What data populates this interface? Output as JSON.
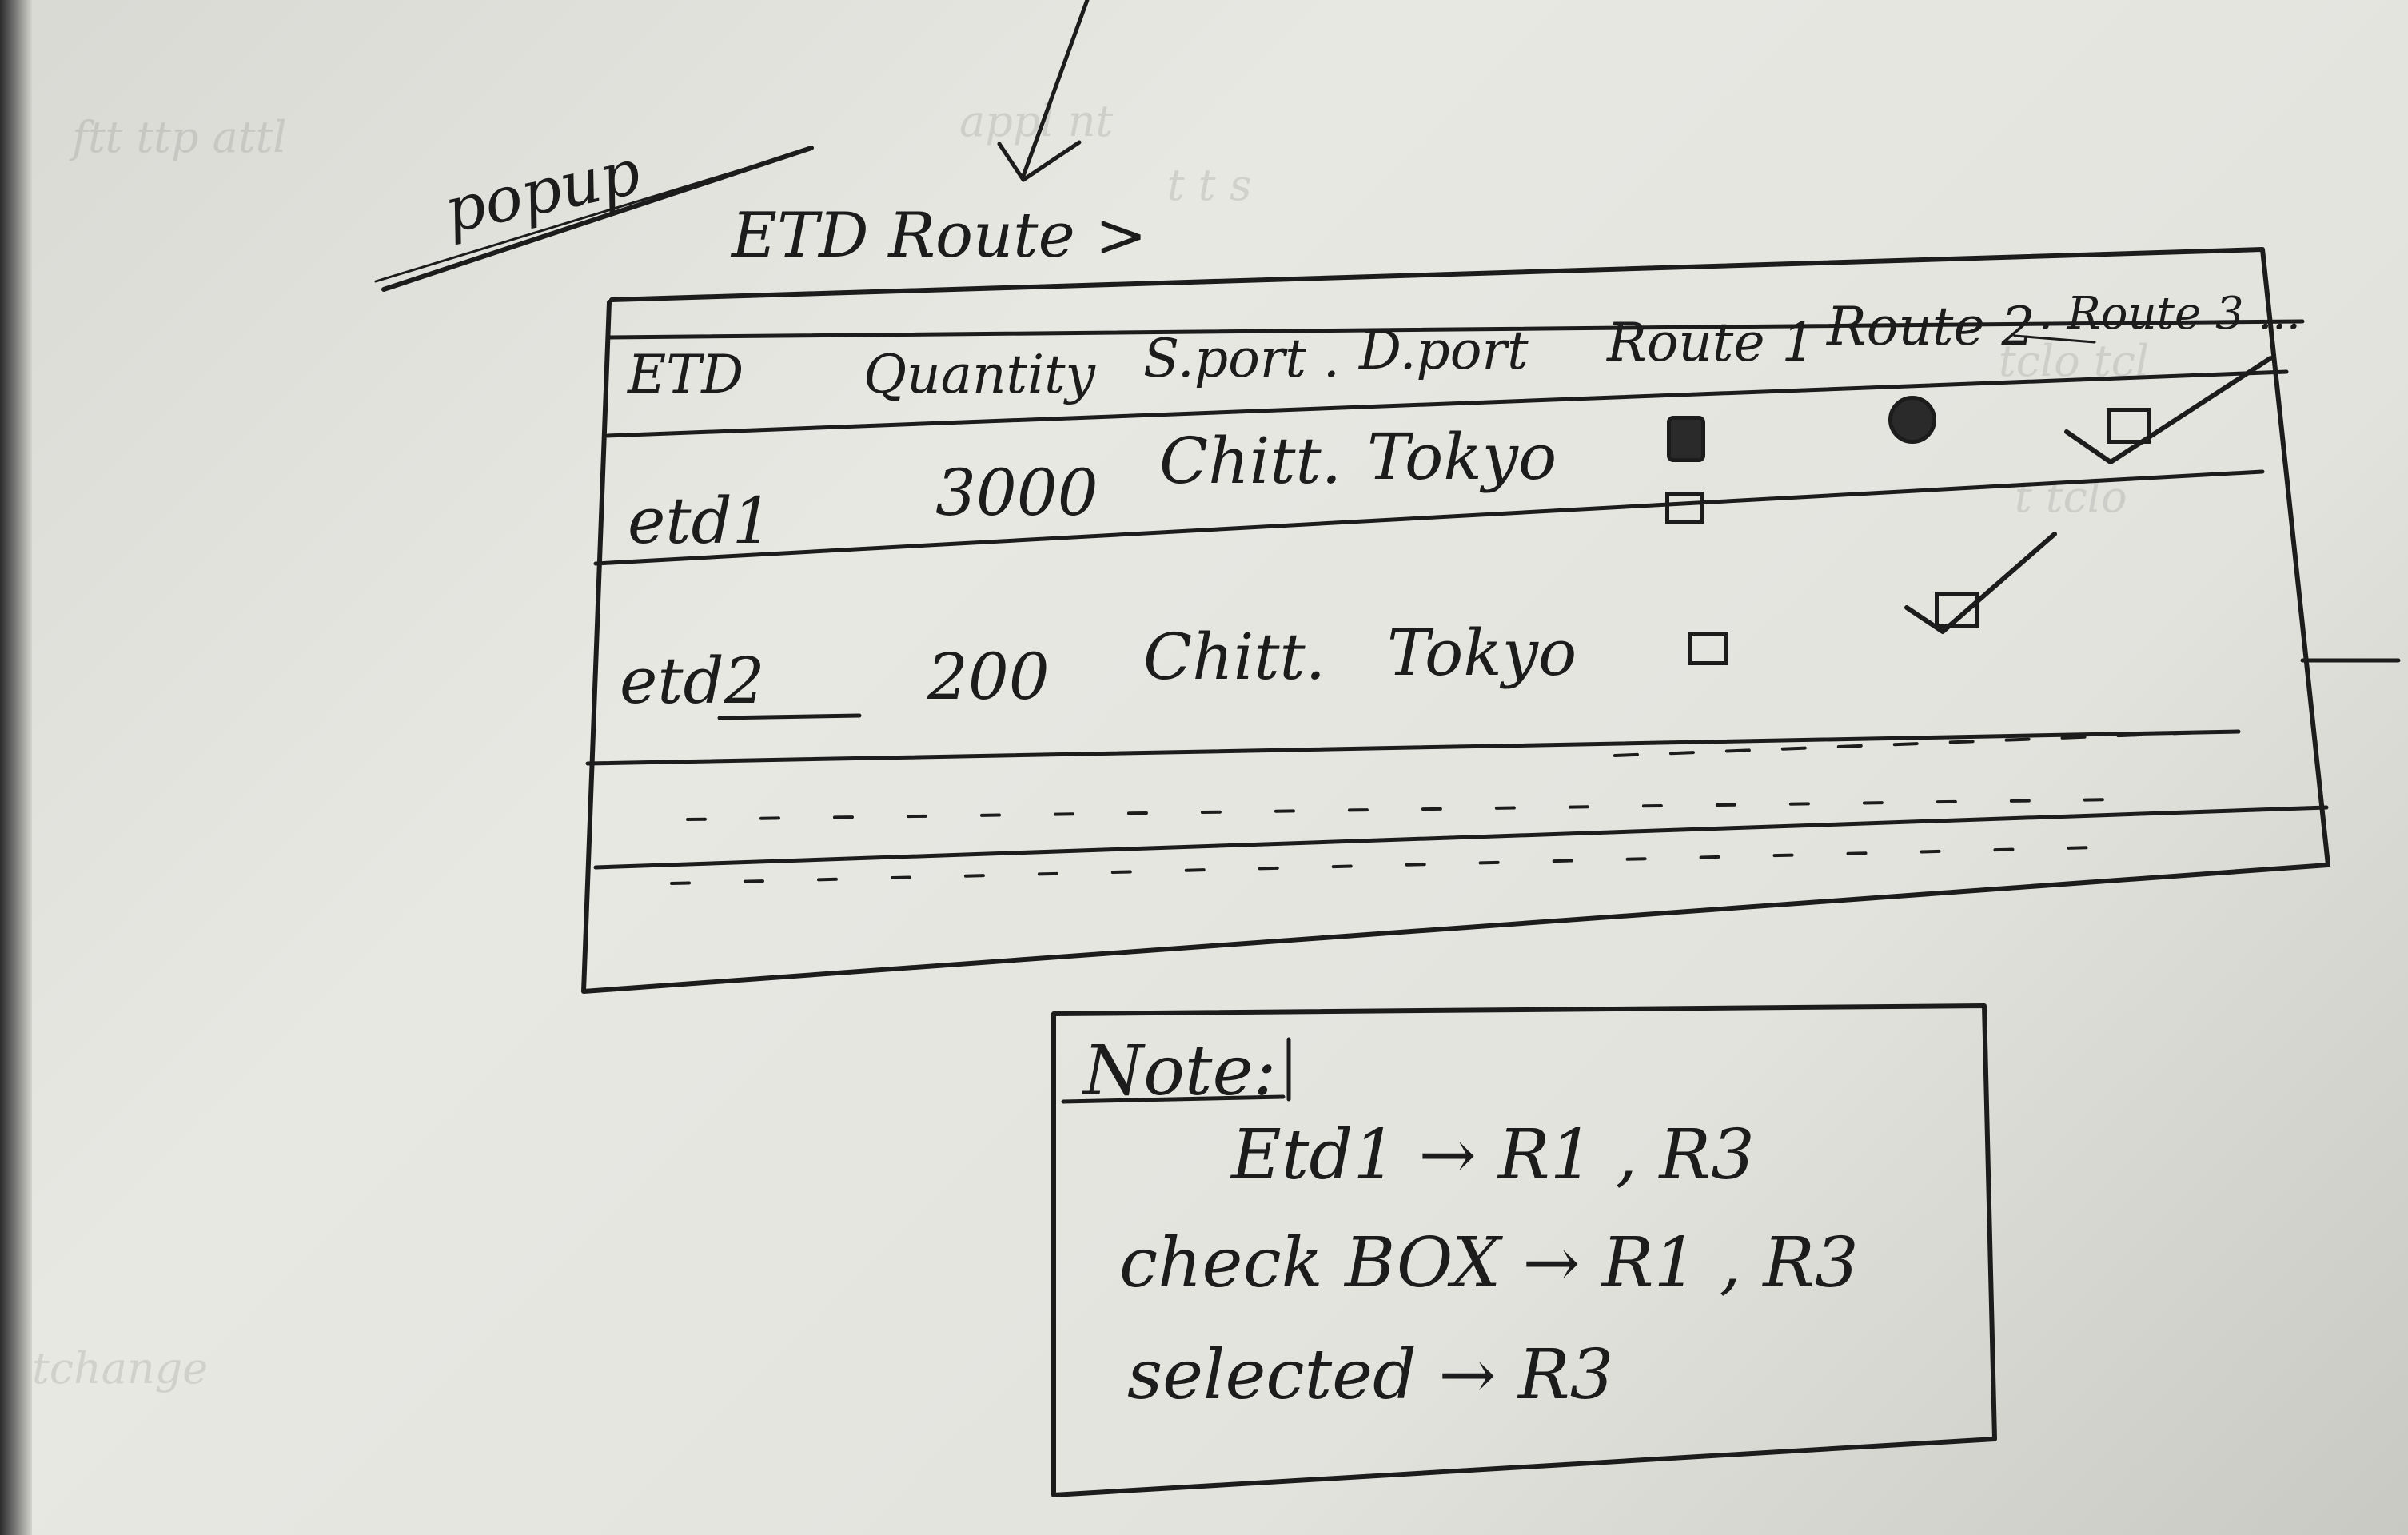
{
  "sketch": {
    "popup_label": "popup",
    "title": "ETD Route >",
    "table": {
      "columns": [
        "ETD",
        "Quantity",
        "S.port .",
        "D.port",
        "Route 1",
        "Route 2",
        ". Route 3 ..."
      ],
      "rows": [
        {
          "etd": "etd1",
          "quantity": "3000",
          "s_port": "Chitt.",
          "d_port": "Tokyo"
        },
        {
          "etd": "etd2",
          "quantity": "200",
          "s_port": "Chitt.",
          "d_port": "Tokyo"
        }
      ]
    },
    "note": {
      "heading": "Note:",
      "lines": [
        "Etd1 → R1 , R3",
        "check BOX → R1 , R3",
        "selected → R3"
      ]
    }
  }
}
